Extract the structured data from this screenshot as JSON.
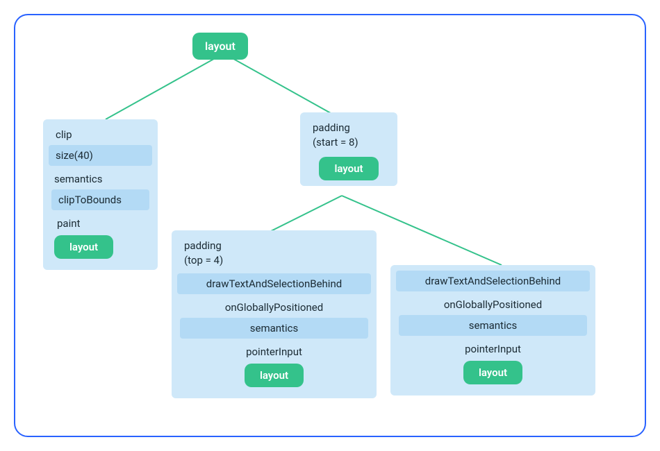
{
  "root": {
    "label": "layout"
  },
  "left": {
    "clip": "clip",
    "size": "size(40)",
    "semantics": "semantics",
    "clipToBounds": "clipToBounds",
    "paint": "paint",
    "layout": "layout"
  },
  "mid": {
    "padding": "padding\n(start = 8)",
    "layout": "layout"
  },
  "bottomLeft": {
    "padding": "padding\n(top = 4)",
    "draw": "drawTextAndSelectionBehind",
    "ogp": "onGloballyPositioned",
    "semantics": "semantics",
    "pointer": "pointerInput",
    "layout": "layout"
  },
  "bottomRight": {
    "draw": "drawTextAndSelectionBehind",
    "ogp": "onGloballyPositioned",
    "semantics": "semantics",
    "pointer": "pointerInput",
    "layout": "layout"
  }
}
